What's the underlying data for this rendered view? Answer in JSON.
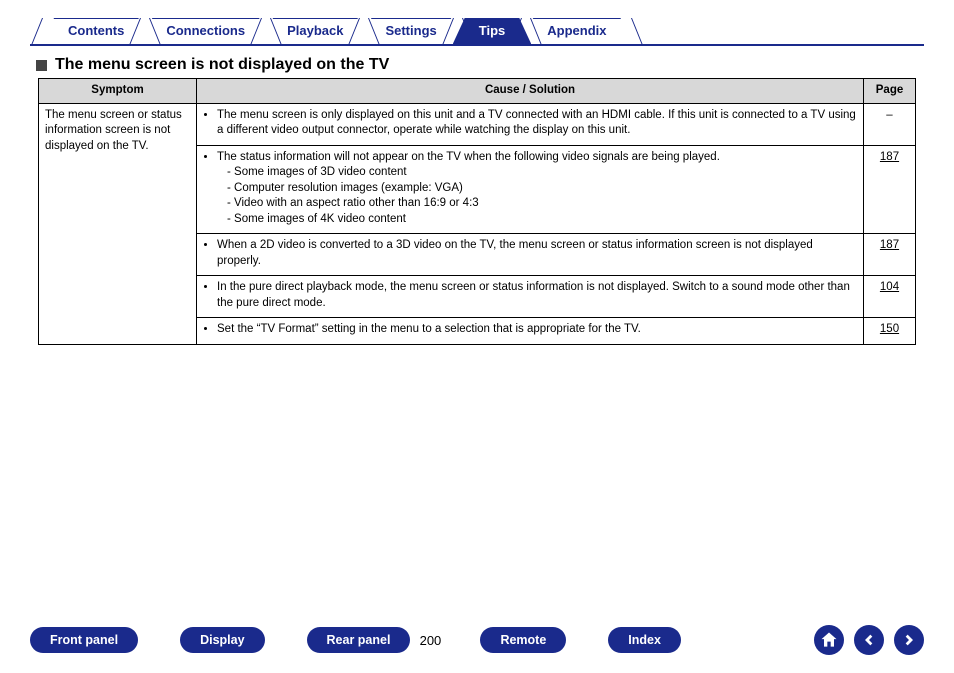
{
  "tabs": {
    "items": [
      {
        "label": "Contents",
        "active": false
      },
      {
        "label": "Connections",
        "active": false
      },
      {
        "label": "Playback",
        "active": false
      },
      {
        "label": "Settings",
        "active": false
      },
      {
        "label": "Tips",
        "active": true
      },
      {
        "label": "Appendix",
        "active": false
      }
    ]
  },
  "heading": "The menu screen is not displayed on the TV",
  "table": {
    "headers": {
      "symptom": "Symptom",
      "cause": "Cause / Solution",
      "page": "Page"
    },
    "symptom": "The menu screen or status information screen is not displayed on the TV.",
    "rows": [
      {
        "cause_main": "The menu screen is only displayed on this unit and a TV connected with an HDMI cable. If this unit is connected to a TV using a different video output connector, operate while watching the display on this unit.",
        "sub": [],
        "page": "–"
      },
      {
        "cause_main": "The status information will not appear on the TV when the following video signals are being played.",
        "sub": [
          "- Some images of 3D video content",
          "- Computer resolution images (example: VGA)",
          "- Video with an aspect ratio other than 16:9 or 4:3",
          "- Some images of 4K video content"
        ],
        "page": "187"
      },
      {
        "cause_main": "When a 2D video is converted to a 3D video on the TV, the menu screen or status information screen is not displayed properly.",
        "sub": [],
        "page": "187"
      },
      {
        "cause_main": "In the pure direct playback mode, the menu screen or status information is not displayed. Switch to a sound mode other than the pure direct mode.",
        "sub": [],
        "page": "104"
      },
      {
        "cause_main": "Set the “TV Format” setting in the menu to a selection that is appropriate for the TV.",
        "sub": [],
        "page": "150"
      }
    ]
  },
  "footer": {
    "buttons": {
      "front": "Front panel",
      "display": "Display",
      "rear": "Rear panel",
      "remote": "Remote",
      "index": "Index"
    },
    "page_number": "200"
  }
}
